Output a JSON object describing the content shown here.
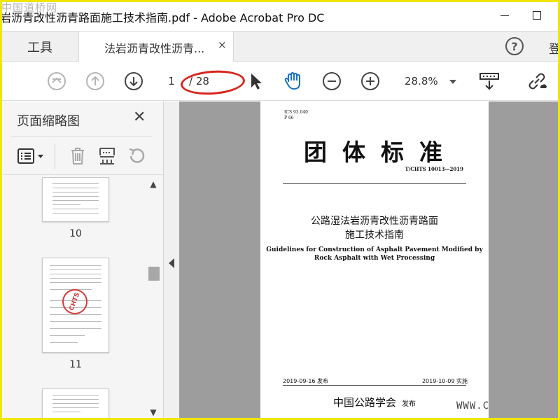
{
  "window": {
    "title": "岩沥青改性沥青路面施工技术指南.pdf - Adobe Acrobat Pro DC",
    "watermark": "中国道桥网"
  },
  "tabs": {
    "tools_label": "工具",
    "doc_label": "法岩沥青改性沥青...",
    "close_glyph": "×",
    "help_glyph": "?",
    "login_label": "登"
  },
  "toolbar": {
    "current_page": "1",
    "page_total": "/ 28",
    "zoom": "28.8%"
  },
  "left_panel": {
    "title": "页面缩略图",
    "close_glyph": "✕",
    "thumbnails": [
      {
        "page": "10"
      },
      {
        "page": "11",
        "stamp": "CHTS"
      }
    ]
  },
  "document": {
    "ics": "ICS 93.040",
    "p": "P 66",
    "big_title": "团体标准",
    "code": "T/CHTS 10013—2019",
    "cn_title_line1": "公路湿法岩沥青改性沥青路面",
    "cn_title_line2": "施工技术指南",
    "en_title_line1": "Guidelines for Construction of Asphalt Pavement Modified by",
    "en_title_line2": "Rock Asphalt with Wet Processing",
    "publish_date": "2019-09-16 发布",
    "effective_date": "2019-10-09 实施",
    "publisher": "中国公路学会",
    "publisher_suffix": "发布"
  },
  "site_watermark": "WWW.C",
  "colors": {
    "frame": "#f2e600",
    "annotation_oval": "#d8261c",
    "hand_tool": "#1a73c8",
    "doc_background": "#9d9d9d"
  }
}
